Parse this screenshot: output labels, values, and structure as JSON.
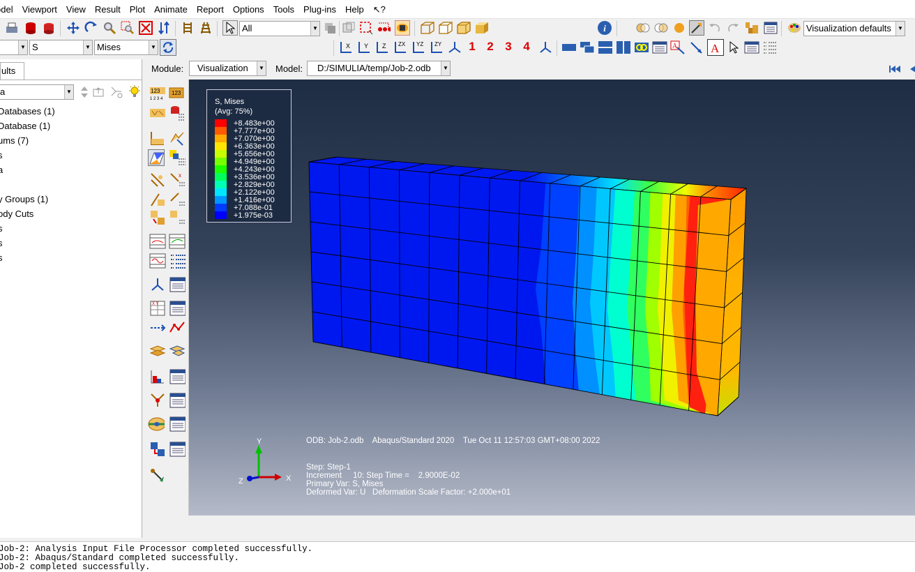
{
  "menubar": {
    "items": [
      "odel",
      "Viewport",
      "View",
      "Result",
      "Plot",
      "Animate",
      "Report",
      "Options",
      "Tools",
      "Plug-ins",
      "Help",
      "↖?"
    ]
  },
  "toolbar1": {
    "selection_filter": "All",
    "render_style": "Visualization defaults"
  },
  "toolbar2": {
    "field_category": "",
    "field_variable": "S",
    "field_invariant": "Mises",
    "triad_numbers": [
      "1",
      "2",
      "3",
      "4"
    ]
  },
  "module_bar": {
    "module_label": "Module:",
    "module_value": "Visualization",
    "model_label": "Model:",
    "model_value": "D:/SIMULIA/temp/Job-2.odb"
  },
  "left_panel": {
    "tab_label": "ults",
    "filter_value": "a",
    "tree_items": [
      "Databases (1)",
      "Database (1)",
      "ums (7)",
      "s",
      "a",
      "",
      "y Groups (1)",
      "ody Cuts",
      "s",
      "s",
      "s"
    ]
  },
  "legend": {
    "title": "S, Mises",
    "subtitle": "(Avg: 75%)",
    "entries": [
      {
        "value": "+8.483e+00",
        "color": "#ff0000"
      },
      {
        "value": "+7.777e+00",
        "color": "#ff5a00"
      },
      {
        "value": "+7.070e+00",
        "color": "#ffaa00"
      },
      {
        "value": "+6.363e+00",
        "color": "#ffe600"
      },
      {
        "value": "+5.656e+00",
        "color": "#c8ff00"
      },
      {
        "value": "+4.949e+00",
        "color": "#78ff00"
      },
      {
        "value": "+4.243e+00",
        "color": "#1eff00"
      },
      {
        "value": "+3.536e+00",
        "color": "#00ff5a"
      },
      {
        "value": "+2.829e+00",
        "color": "#00ffb4"
      },
      {
        "value": "+2.122e+00",
        "color": "#00e6ff"
      },
      {
        "value": "+1.416e+00",
        "color": "#0096ff"
      },
      {
        "value": "+7.088e-01",
        "color": "#003cff"
      },
      {
        "value": "+1.975e-03",
        "color": "#0000ff"
      }
    ]
  },
  "viewport_info": {
    "odb_line": "ODB: Job-2.odb    Abaqus/Standard 2020    Tue Oct 11 12:57:03 GMT+08:00 2022",
    "step": "Step: Step-1",
    "increment": "Increment     10: Step Time =    2.9000E-02",
    "primary_var": "Primary Var: S, Mises",
    "deformed_var": "Deformed Var: U   Deformation Scale Factor: +2.000e+01"
  },
  "triad": {
    "x": "X",
    "y": "Y",
    "z": "Z"
  },
  "messages": [
    "Job-2: Analysis Input File Processor completed successfully.",
    "Job-2: Abaqus/Standard completed successfully.",
    "Job-2 completed successfully."
  ],
  "colors": {
    "model_blue": "#0018f0",
    "edge_color": "#000000",
    "viewport_top": "#1e2d44",
    "viewport_bottom": "#b4bac8"
  }
}
